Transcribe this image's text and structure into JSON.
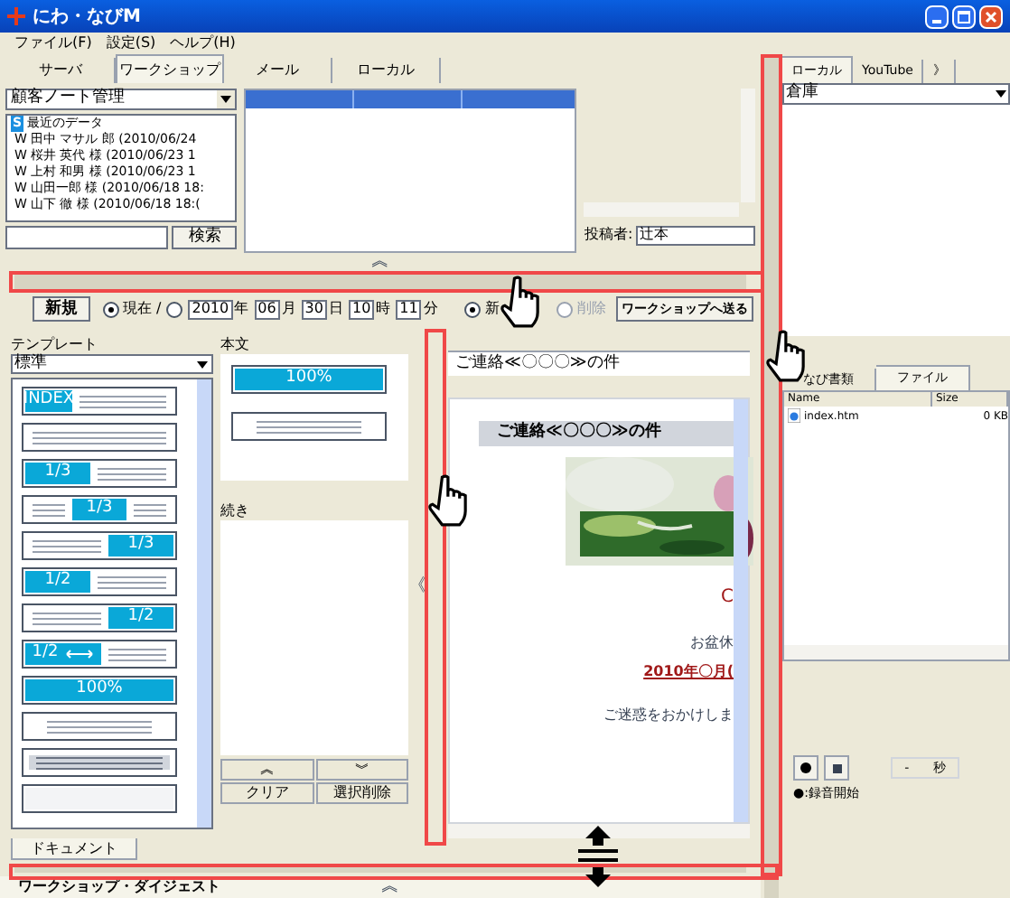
{
  "window": {
    "title": "にわ・なびM"
  },
  "menu": [
    "ファイル(F)",
    "設定(S)",
    "ヘルプ(H)"
  ],
  "tabs": [
    {
      "label": "サーバ",
      "selected": false
    },
    {
      "label": "ワークショップ",
      "selected": true
    },
    {
      "label": "メール",
      "selected": false
    },
    {
      "label": "ローカル",
      "selected": false
    }
  ],
  "customer_dropdown": {
    "value": "顧客ノート管理"
  },
  "tree": {
    "badge": "S",
    "label": "最近のデータ",
    "children": [
      {
        "mark": "W",
        "label": "田中 マサル 郎 (2010/06/24"
      },
      {
        "mark": "W",
        "label": "桜井 英代 様 (2010/06/23 1"
      },
      {
        "mark": "W",
        "label": "上村 和男 様 (2010/06/23 1"
      },
      {
        "mark": "W",
        "label": "山田一郎 様 (2010/06/18 18:"
      },
      {
        "mark": "W",
        "label": "山下 徹 様 (2010/06/18 18:("
      }
    ]
  },
  "search": {
    "button": "検索"
  },
  "poster": {
    "label": "投稿者:",
    "value": "辻本"
  },
  "collapse_top": "︽",
  "toolbar": {
    "new_button": "新規",
    "time_radios": [
      {
        "label": "現在 /",
        "selected": true
      },
      {
        "selected": false
      }
    ],
    "date": [
      {
        "value": "2010",
        "unit": "年"
      },
      {
        "value": "06",
        "unit": "月"
      },
      {
        "value": "30",
        "unit": "日"
      },
      {
        "value": "10",
        "unit": "時"
      },
      {
        "value": "11",
        "unit": "分"
      }
    ],
    "mode_radios": [
      {
        "label": "新",
        "selected": true,
        "disabled": false
      },
      {
        "label": "削除",
        "selected": false,
        "disabled": true
      }
    ],
    "send_button": "ワークショップへ送る"
  },
  "template": {
    "label": "テンプレート",
    "value": "標準",
    "items": [
      {
        "kind": "index",
        "label": "INDEX"
      },
      {
        "kind": "lines"
      },
      {
        "kind": "left",
        "label": "1/3"
      },
      {
        "kind": "mid",
        "label": "1/3"
      },
      {
        "kind": "right",
        "label": "1/3"
      },
      {
        "kind": "left",
        "label": "1/2"
      },
      {
        "kind": "right",
        "label": "1/2"
      },
      {
        "kind": "split",
        "label": "1/2"
      },
      {
        "kind": "full",
        "label": "100%"
      },
      {
        "kind": "center"
      },
      {
        "kind": "gray"
      },
      {
        "kind": "blank"
      }
    ]
  },
  "body": {
    "label": "本文",
    "items": [
      {
        "kind": "full",
        "label": "100%"
      },
      {
        "kind": "center"
      }
    ]
  },
  "continuation": {
    "label": "続き"
  },
  "list_buttons": {
    "up": "︽",
    "down": "︾",
    "clear": "クリア",
    "delete": "選択削除"
  },
  "collapse_left": "《",
  "subject": "ご連絡≪〇〇〇≫の件",
  "preview": {
    "heading": "ご連絡≪〇〇〇≫の件",
    "lines": [
      {
        "kind": "link",
        "text": "C"
      },
      {
        "kind": "plain",
        "text": "お盆休"
      },
      {
        "kind": "date",
        "text": "2010年〇月("
      },
      {
        "kind": "plain",
        "text": "ご迷惑をおかけしま"
      }
    ]
  },
  "doc_tab": "ドキュメント",
  "digest": {
    "label": "ワークショップ・ダイジェスト",
    "toggle": "︽"
  },
  "right_tabs": [
    {
      "label": "ローカル",
      "selected": true
    },
    {
      "label": "YouTube",
      "selected": false
    },
    {
      "label": "》",
      "selected": false
    }
  ],
  "store_dropdown": {
    "value": "倉庫"
  },
  "file_tabs": [
    {
      "label": "なび書類",
      "selected": false
    },
    {
      "label": "ファイル",
      "selected": true
    }
  ],
  "file_columns": [
    "Name",
    "Size"
  ],
  "files": [
    {
      "name": "index.htm",
      "size": "0 KB"
    }
  ],
  "recorder": {
    "time": "-",
    "unit": "秒",
    "hint": "●:録音開始"
  }
}
